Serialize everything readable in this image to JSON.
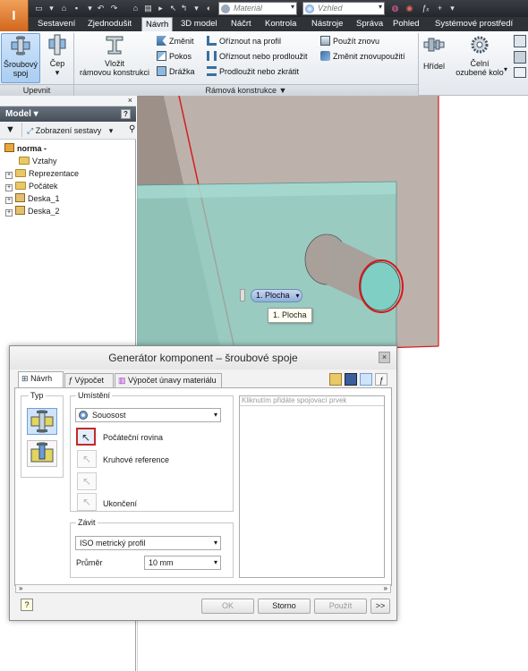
{
  "qat": {
    "material_label": "Materiál",
    "appearance_label": "Vzhled"
  },
  "tabs": [
    "Sestavení",
    "Zjednodušit",
    "Návrh",
    "3D model",
    "Náčrt",
    "Kontrola",
    "Nástroje",
    "Správa",
    "Pohled",
    "Systémové prostředí"
  ],
  "ribbon": {
    "upevnit": {
      "bolt_label_1": "Šroubový",
      "bolt_label_2": "spoj",
      "pin_label": "Čep",
      "panel": "Upevnit"
    },
    "frame": {
      "insert_1": "Vložit",
      "insert_2": "rámovou konstrukci",
      "change": "Změnit",
      "pokos": "Pokos",
      "drazka": "Drážka",
      "trim_to_profile": "Oříznout na profil",
      "trim_extend": "Oříznout nebo prodloužit",
      "extend_shorten": "Prodloužit nebo zkrátit",
      "reuse": "Použít znovu",
      "change_reuse": "Změnit znovupoužití",
      "panel": "Rámová konstrukce ▼"
    },
    "power": {
      "shaft": "Hřídel",
      "gear_1": "Čelní",
      "gear_2": "ozubené kolo"
    }
  },
  "browser": {
    "header": "Model ▾",
    "view_label": "Zobrazení sestavy",
    "root": "norma -",
    "items": [
      "Vztahy",
      "Reprezentace",
      "Počátek",
      "Deska_1",
      "Deska_2"
    ]
  },
  "viewport": {
    "tag_label": "1. Plocha",
    "tooltip": "1. Plocha"
  },
  "dialog": {
    "title": "Generátor komponent – šroubové spoje",
    "tabs": [
      "Návrh",
      "Výpočet",
      "Výpočet únavy materiálu"
    ],
    "typ_label": "Typ",
    "umisteni_label": "Umístění",
    "placement_value": "Souosost",
    "start_plane": "Počáteční rovina",
    "circular_ref": "Kruhové reference",
    "termination": "Ukončení",
    "thread_label": "Závit",
    "thread_value": "ISO metrický profil",
    "diameter_label": "Průměr",
    "diameter_value": "10 mm",
    "list_placeholder": "Kliknutím přidáte spojovací prvek",
    "ok": "OK",
    "cancel": "Storno",
    "apply": "Použít",
    "more": ">>"
  }
}
